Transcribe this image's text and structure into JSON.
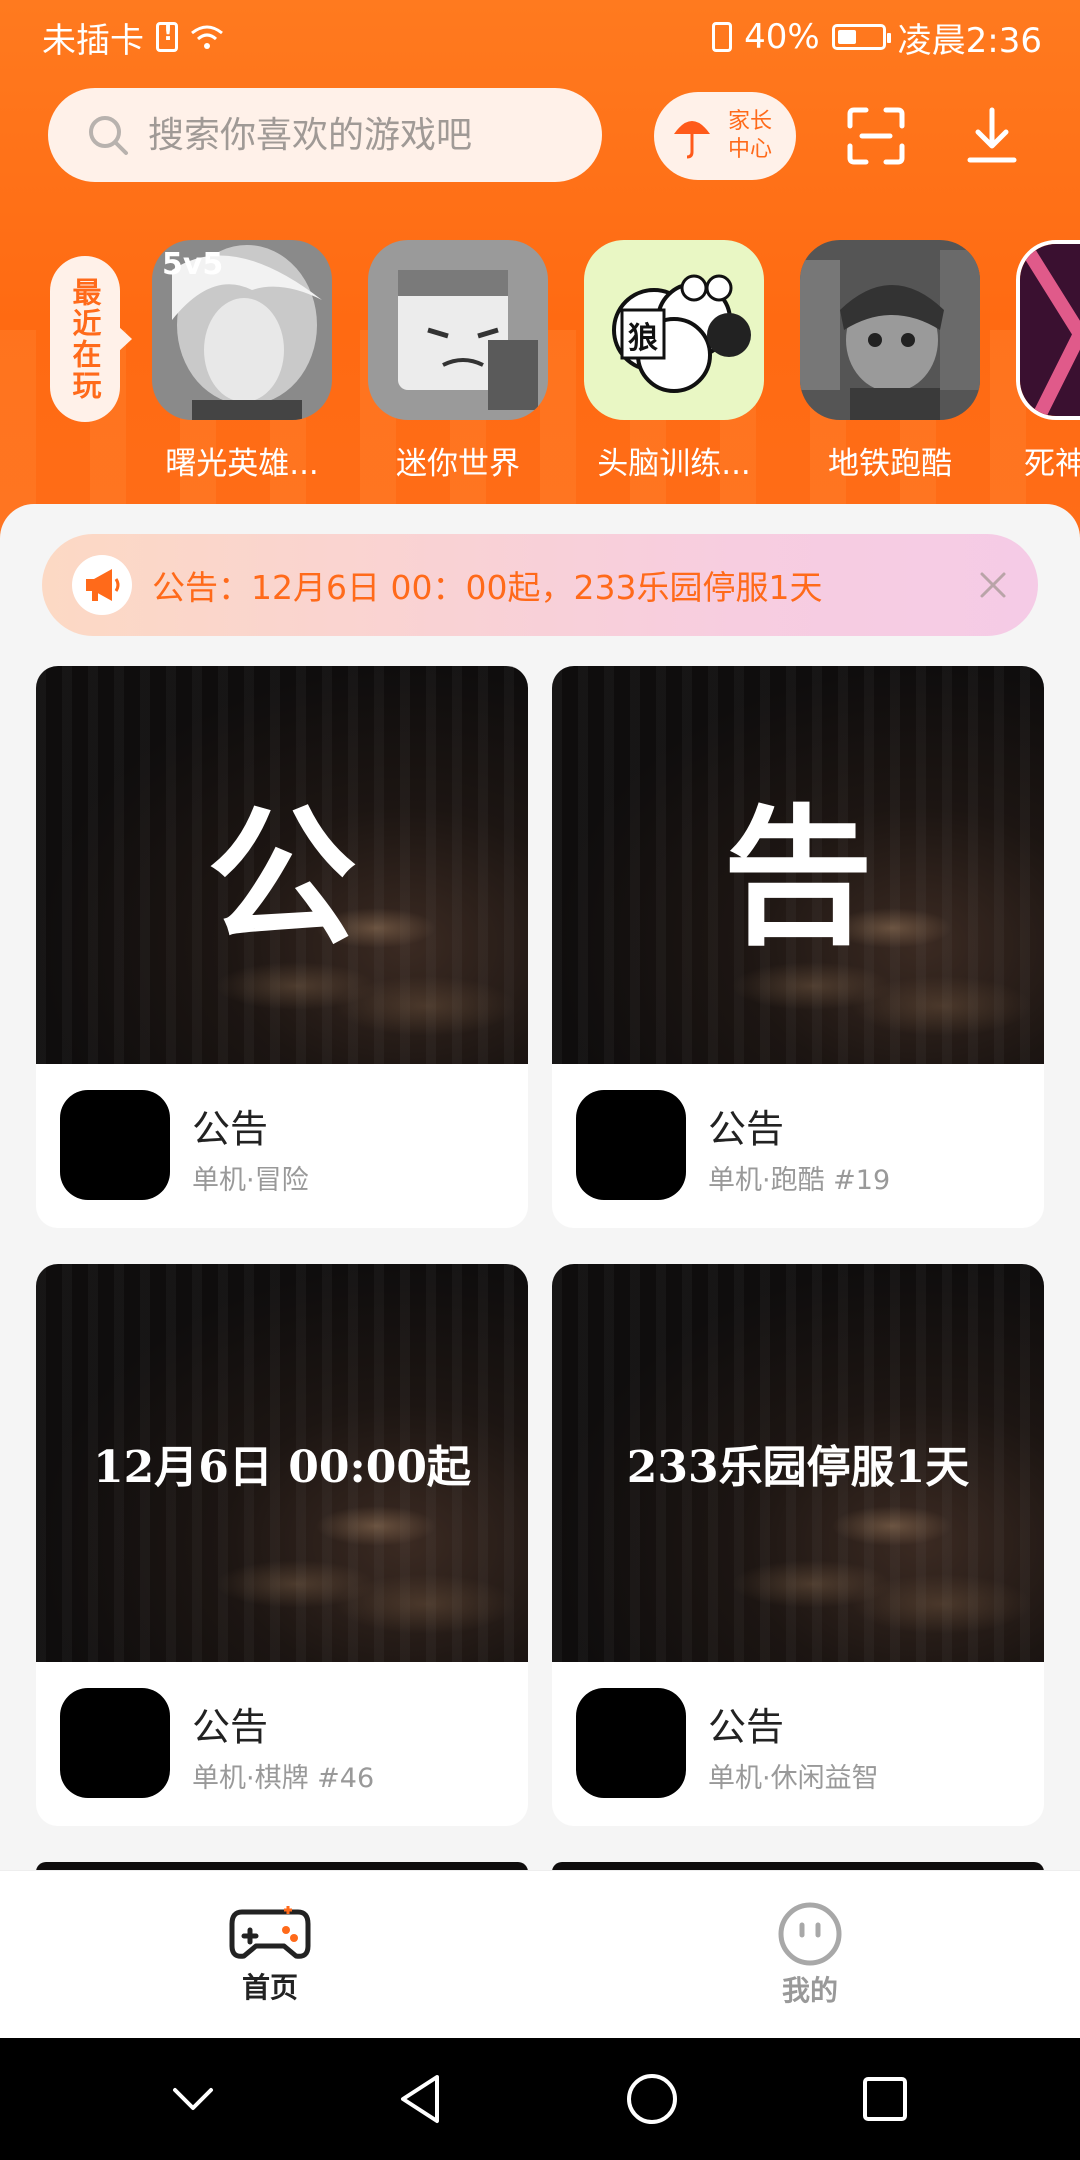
{
  "status_bar": {
    "carrier": "未插卡",
    "battery": "40%",
    "time": "凌晨2:36"
  },
  "header": {
    "search_placeholder": "搜索你喜欢的游戏吧",
    "parent_center_line1": "家长",
    "parent_center_line2": "中心"
  },
  "recent": {
    "label": "最近在玩",
    "games": [
      {
        "name": "曙光英雄...",
        "badge": "5v5"
      },
      {
        "name": "迷你世界"
      },
      {
        "name": "头脑训练...",
        "badge": "狼"
      },
      {
        "name": "地铁跑酷"
      },
      {
        "name": "死神"
      }
    ]
  },
  "notice": {
    "text": "公告：12月6日 00：00起，233乐园停服1天"
  },
  "cards": [
    {
      "cover_text": "公",
      "title": "公告",
      "sub": "单机·冒险"
    },
    {
      "cover_text": "告",
      "title": "公告",
      "sub": "单机·跑酷 #19"
    },
    {
      "cover_text": "12月6日 00:00起",
      "title": "公告",
      "sub": "单机·棋牌 #46"
    },
    {
      "cover_text": "233乐园停服1天",
      "title": "公告",
      "sub": "单机·休闲益智"
    }
  ],
  "bottom_nav": {
    "home": "首页",
    "mine": "我的"
  },
  "colors": {
    "accent": "#ff6a1a",
    "header": "#ff7a1f"
  }
}
